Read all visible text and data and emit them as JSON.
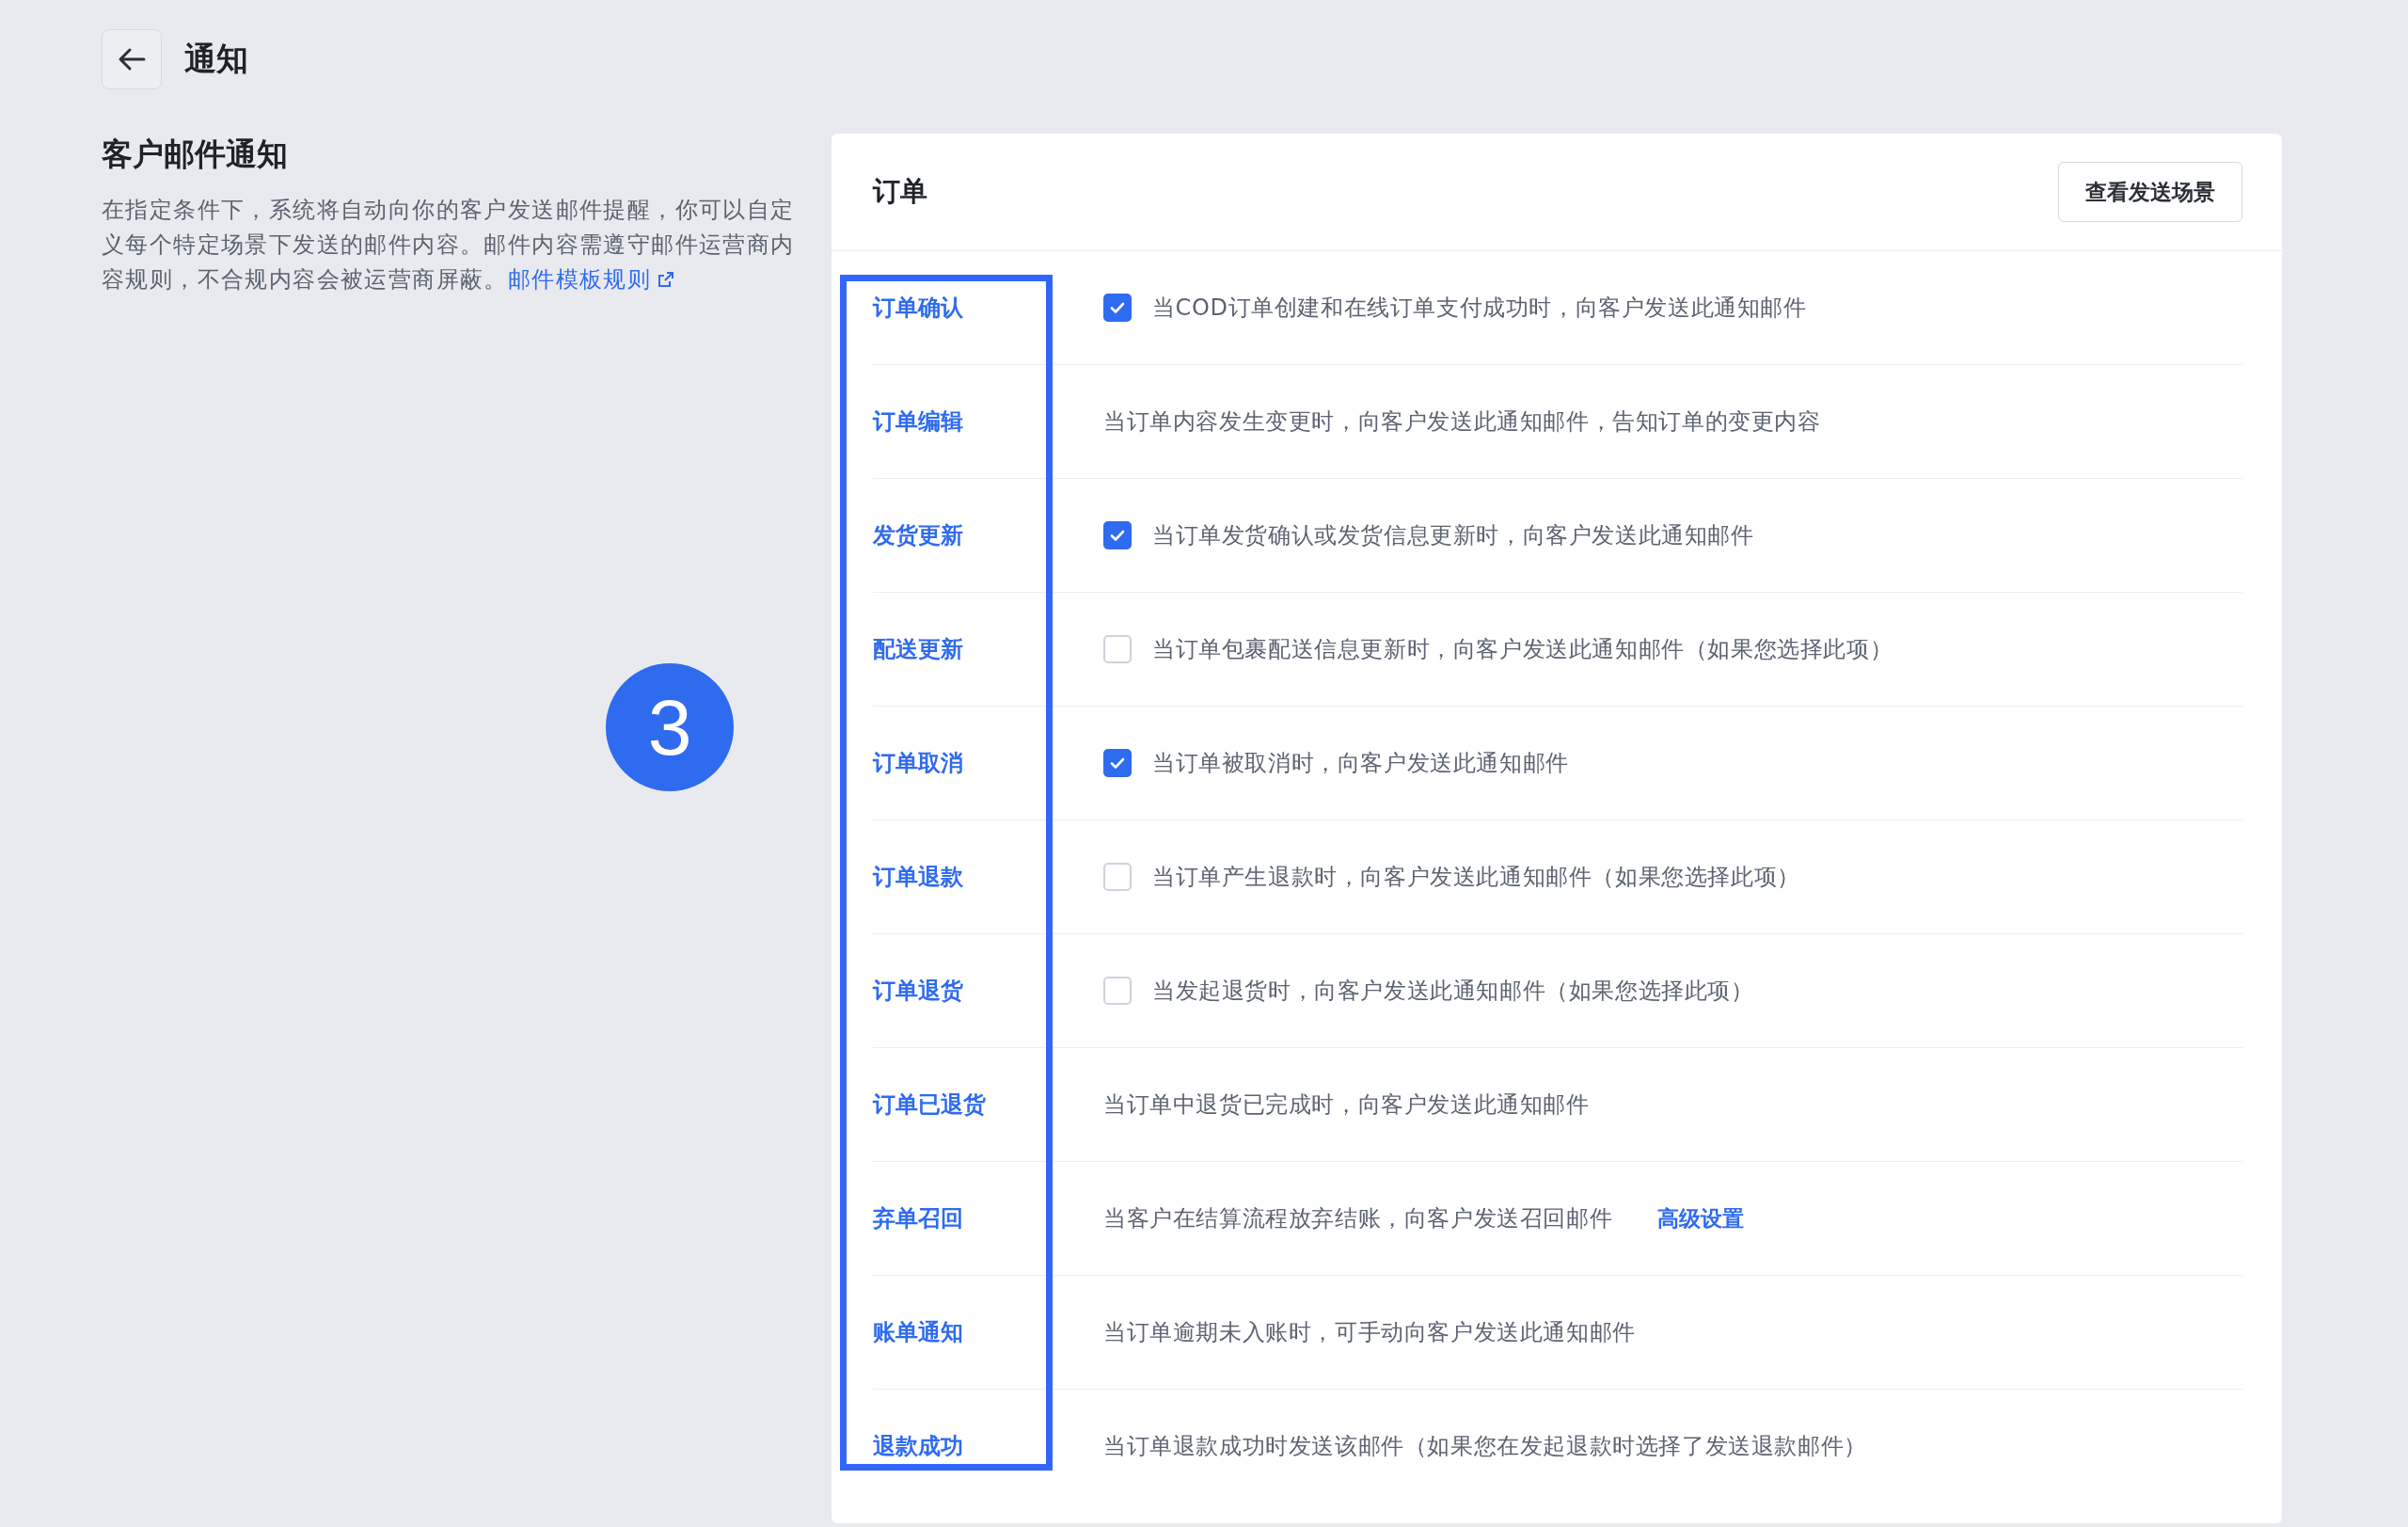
{
  "header": {
    "title": "通知"
  },
  "intro": {
    "heading": "客户邮件通知",
    "description": "在指定条件下，系统将自动向你的客户发送邮件提醒，你可以自定义每个特定场景下发送的邮件内容。邮件内容需遵守邮件运营商内容规则，不合规内容会被运营商屏蔽。",
    "link": "邮件模板规则"
  },
  "card": {
    "title": "订单",
    "button": "查看发送场景",
    "rows": [
      {
        "kind": "checkbox",
        "label": "订单确认",
        "description": "当COD订单创建和在线订单支付成功时，向客户发送此通知邮件",
        "checked": true
      },
      {
        "kind": "text",
        "label": "订单编辑",
        "description": "当订单内容发生变更时，向客户发送此通知邮件，告知订单的变更内容"
      },
      {
        "kind": "checkbox",
        "label": "发货更新",
        "description": "当订单发货确认或发货信息更新时，向客户发送此通知邮件",
        "checked": true
      },
      {
        "kind": "checkbox",
        "label": "配送更新",
        "description": "当订单包裹配送信息更新时，向客户发送此通知邮件（如果您选择此项）",
        "checked": false
      },
      {
        "kind": "checkbox",
        "label": "订单取消",
        "description": "当订单被取消时，向客户发送此通知邮件",
        "checked": true
      },
      {
        "kind": "checkbox",
        "label": "订单退款",
        "description": "当订单产生退款时，向客户发送此通知邮件（如果您选择此项）",
        "checked": false
      },
      {
        "kind": "checkbox",
        "label": "订单退货",
        "description": "当发起退货时，向客户发送此通知邮件（如果您选择此项）",
        "checked": false
      },
      {
        "kind": "text",
        "label": "订单已退货",
        "description": "当订单中退货已完成时，向客户发送此通知邮件"
      },
      {
        "kind": "text",
        "label": "弃单召回",
        "description": "当客户在结算流程放弃结账，向客户发送召回邮件",
        "link": "高级设置"
      },
      {
        "kind": "text",
        "label": "账单通知",
        "description": "当订单逾期未入账时，可手动向客户发送此通知邮件"
      },
      {
        "kind": "text",
        "label": "退款成功",
        "description": "当订单退款成功时发送该邮件（如果您在发起退款时选择了发送退款邮件）"
      }
    ]
  },
  "callout": {
    "number": "3"
  }
}
